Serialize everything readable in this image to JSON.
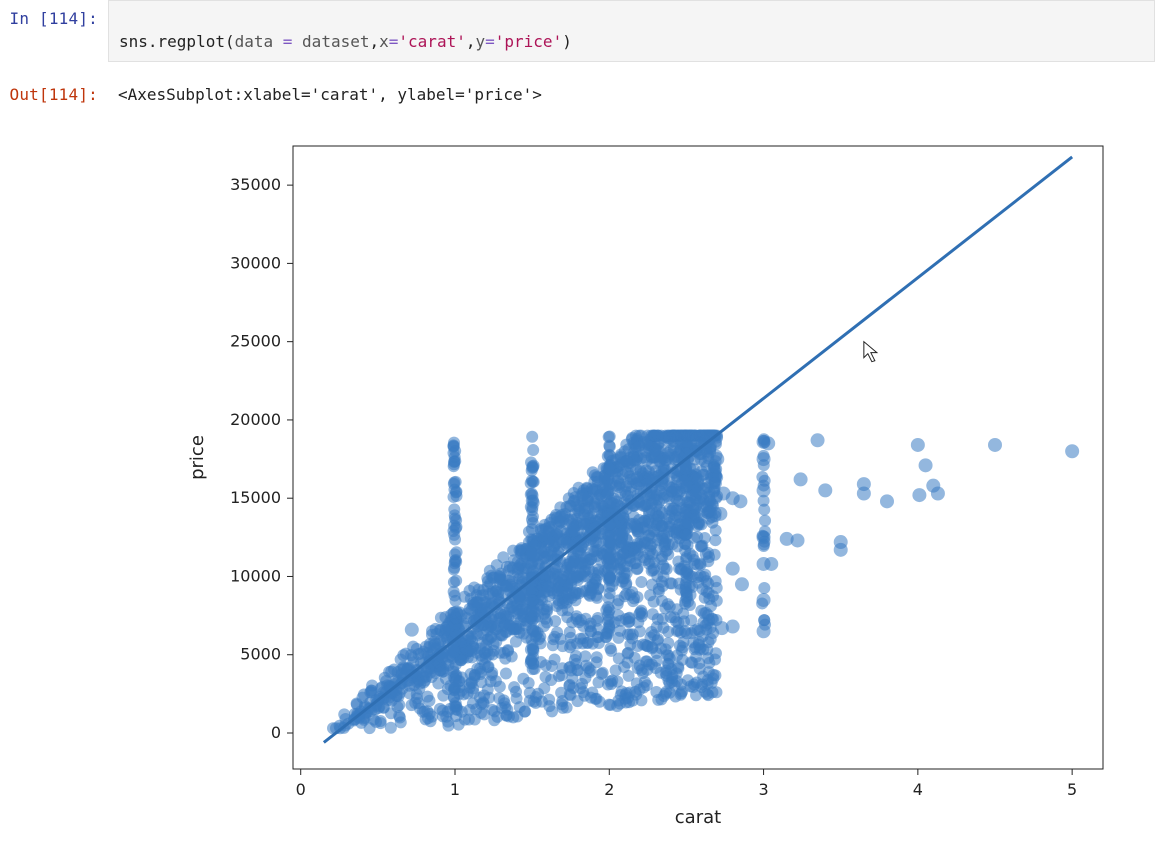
{
  "notebook": {
    "input_prompt": "In [114]:",
    "output_prompt": "Out[114]:",
    "code": {
      "func": "sns.regplot",
      "open": "(",
      "arg1_key": "data",
      "eq1": " = ",
      "arg1_val": "dataset",
      "sep1": ",",
      "arg2_key": "x",
      "eq2": "=",
      "arg2_val": "'carat'",
      "sep2": ",",
      "arg3_key": "y",
      "eq3": "=",
      "arg3_val": "'price'",
      "close": ")"
    },
    "output_text": "<AxesSubplot:xlabel='carat', ylabel='price'>"
  },
  "chart_data": {
    "type": "scatter",
    "xlabel": "carat",
    "ylabel": "price",
    "xlim": [
      -0.05,
      5.2
    ],
    "ylim": [
      -2300,
      37500
    ],
    "xticks": [
      0,
      1,
      2,
      3,
      4,
      5
    ],
    "yticks": [
      0,
      5000,
      10000,
      15000,
      20000,
      25000,
      30000,
      35000
    ],
    "regression_line": {
      "x0": 0.15,
      "y0": -600,
      "x1": 5.0,
      "y1": 36800
    },
    "point_color": "#3b7cc2",
    "line_color": "#2f6fb3",
    "dense_region": {
      "comment": "Main scatter mass: dense between carat 0.2-2.7, price 300-19000",
      "x_min": 0.2,
      "x_max": 2.7,
      "y_min": 300,
      "y_max": 19000,
      "count": 2200
    },
    "column_strips": [
      {
        "x": 1.0,
        "y_min": 1500,
        "y_max": 19000,
        "count": 70
      },
      {
        "x": 1.5,
        "y_min": 4000,
        "y_max": 19000,
        "count": 60
      },
      {
        "x": 2.0,
        "y_min": 6000,
        "y_max": 19000,
        "count": 55
      },
      {
        "x": 2.5,
        "y_min": 8000,
        "y_max": 19000,
        "count": 40
      },
      {
        "x": 3.0,
        "y_min": 6500,
        "y_max": 19000,
        "count": 22
      }
    ],
    "sparse_points": [
      {
        "x": 0.72,
        "y": 6600
      },
      {
        "x": 2.55,
        "y": 18600
      },
      {
        "x": 2.62,
        "y": 18600
      },
      {
        "x": 2.7,
        "y": 17500
      },
      {
        "x": 2.72,
        "y": 14000
      },
      {
        "x": 2.73,
        "y": 6700
      },
      {
        "x": 2.74,
        "y": 15300
      },
      {
        "x": 2.8,
        "y": 15000
      },
      {
        "x": 2.8,
        "y": 10500
      },
      {
        "x": 2.8,
        "y": 6800
      },
      {
        "x": 2.85,
        "y": 14800
      },
      {
        "x": 2.86,
        "y": 9500
      },
      {
        "x": 3.0,
        "y": 18600
      },
      {
        "x": 3.0,
        "y": 17500
      },
      {
        "x": 3.0,
        "y": 15500
      },
      {
        "x": 3.0,
        "y": 12500
      },
      {
        "x": 3.0,
        "y": 10800
      },
      {
        "x": 3.0,
        "y": 8500
      },
      {
        "x": 3.0,
        "y": 6500
      },
      {
        "x": 3.03,
        "y": 18500
      },
      {
        "x": 3.05,
        "y": 10800
      },
      {
        "x": 3.15,
        "y": 12400
      },
      {
        "x": 3.22,
        "y": 12300
      },
      {
        "x": 3.24,
        "y": 16200
      },
      {
        "x": 3.35,
        "y": 18700
      },
      {
        "x": 3.4,
        "y": 15500
      },
      {
        "x": 3.5,
        "y": 12200
      },
      {
        "x": 3.5,
        "y": 11700
      },
      {
        "x": 3.65,
        "y": 15300
      },
      {
        "x": 3.65,
        "y": 15900
      },
      {
        "x": 3.8,
        "y": 14800
      },
      {
        "x": 4.0,
        "y": 18400
      },
      {
        "x": 4.01,
        "y": 15200
      },
      {
        "x": 4.05,
        "y": 17100
      },
      {
        "x": 4.1,
        "y": 15800
      },
      {
        "x": 4.13,
        "y": 15300
      },
      {
        "x": 4.5,
        "y": 18400
      },
      {
        "x": 5.0,
        "y": 18000
      }
    ]
  }
}
